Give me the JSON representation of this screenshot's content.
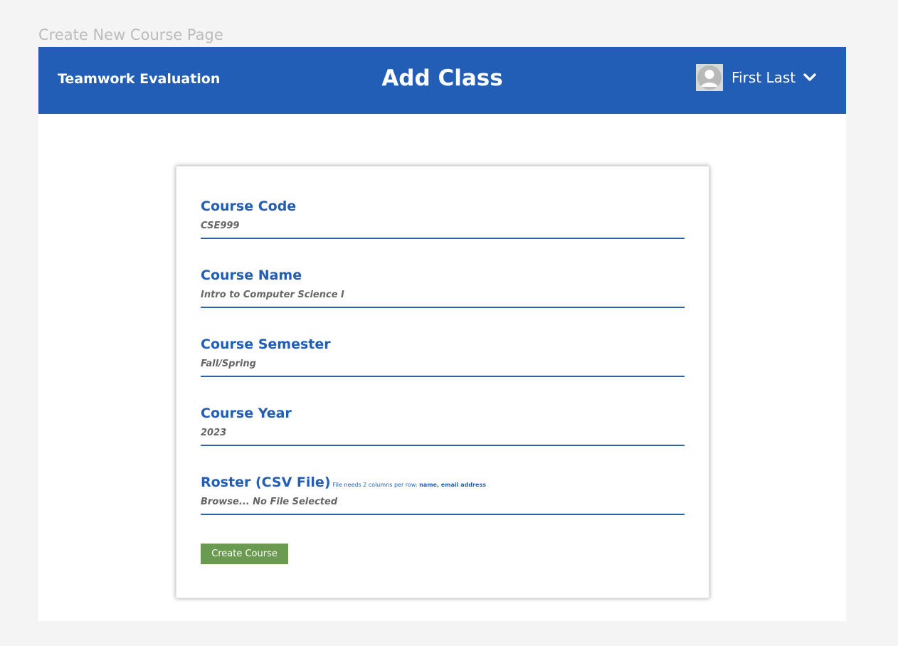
{
  "frame_label": "Create New Course Page",
  "navbar": {
    "brand": "Teamwork Evaluation",
    "title": "Add Class",
    "user_name": "First Last",
    "avatar_icon": "user-avatar-icon",
    "menu_icon": "chevron-down-icon"
  },
  "form": {
    "fields": [
      {
        "label": "Course Code",
        "value": "CSE999"
      },
      {
        "label": "Course Name",
        "value": "Intro to Computer Science I"
      },
      {
        "label": "Course Semester",
        "value": "Fall/Spring"
      },
      {
        "label": "Course Year",
        "value": "2023"
      },
      {
        "label": "Roster (CSV File)",
        "hint_prefix": "File needs 2 columns per row: ",
        "hint_bold": "name, email address",
        "value": "Browse... No File Selected"
      }
    ],
    "submit_label": "Create Course"
  },
  "colors": {
    "header_bg": "#225eb6",
    "label_blue": "#225eb6",
    "button_green": "#6a9a50",
    "page_bg": "#f4f4f4"
  }
}
